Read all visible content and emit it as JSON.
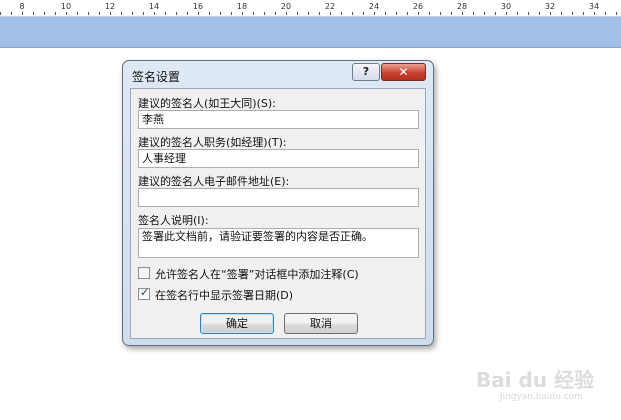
{
  "ruler": {
    "numbers": [
      "8",
      "10",
      "12",
      "14",
      "16",
      "18",
      "20",
      "22",
      "24",
      "26",
      "28",
      "30",
      "32",
      "34"
    ]
  },
  "dialog": {
    "title": "签名设置",
    "help_label": "?",
    "close_label": "✕",
    "suggested_signer_label": "建议的签名人(如王大同)(S):",
    "suggested_signer_value": "李燕",
    "suggested_title_label": "建议的签名人职务(如经理)(T):",
    "suggested_title_value": "人事经理",
    "suggested_email_label": "建议的签名人电子邮件地址(E):",
    "suggested_email_value": "",
    "instructions_label": "签名人说明(I):",
    "instructions_value": "签署此文档前，请验证要签署的内容是否正确。",
    "allow_comments_label": "允许签名人在“签署”对话框中添加注释(C)",
    "allow_comments_checked": false,
    "show_date_label": "在签名行中显示签署日期(D)",
    "show_date_checked": true,
    "ok_label": "确定",
    "cancel_label": "取消"
  },
  "watermark": {
    "main": "Bai du 经验",
    "sub": "jingyan.baidu.com"
  }
}
